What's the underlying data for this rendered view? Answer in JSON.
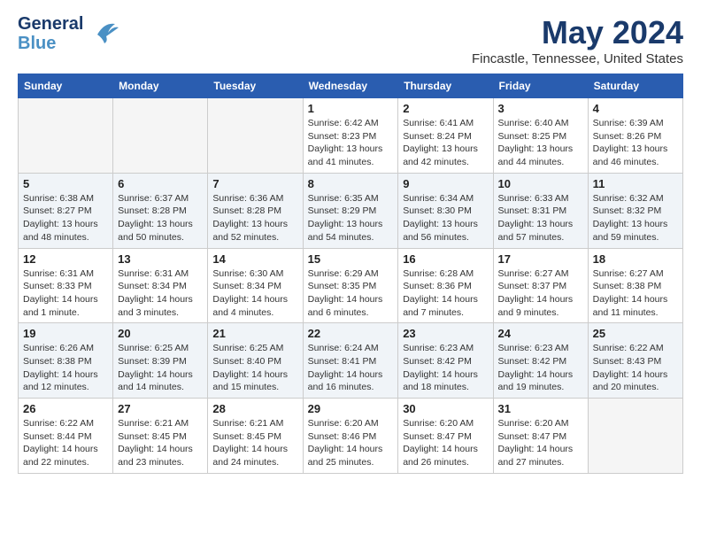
{
  "logo": {
    "general": "General",
    "blue": "Blue"
  },
  "title": "May 2024",
  "location": "Fincastle, Tennessee, United States",
  "days_of_week": [
    "Sunday",
    "Monday",
    "Tuesday",
    "Wednesday",
    "Thursday",
    "Friday",
    "Saturday"
  ],
  "weeks": [
    [
      {
        "day": "",
        "sunrise": "",
        "sunset": "",
        "daylight": "",
        "empty": true
      },
      {
        "day": "",
        "sunrise": "",
        "sunset": "",
        "daylight": "",
        "empty": true
      },
      {
        "day": "",
        "sunrise": "",
        "sunset": "",
        "daylight": "",
        "empty": true
      },
      {
        "day": "1",
        "sunrise": "Sunrise: 6:42 AM",
        "sunset": "Sunset: 8:23 PM",
        "daylight": "Daylight: 13 hours and 41 minutes."
      },
      {
        "day": "2",
        "sunrise": "Sunrise: 6:41 AM",
        "sunset": "Sunset: 8:24 PM",
        "daylight": "Daylight: 13 hours and 42 minutes."
      },
      {
        "day": "3",
        "sunrise": "Sunrise: 6:40 AM",
        "sunset": "Sunset: 8:25 PM",
        "daylight": "Daylight: 13 hours and 44 minutes."
      },
      {
        "day": "4",
        "sunrise": "Sunrise: 6:39 AM",
        "sunset": "Sunset: 8:26 PM",
        "daylight": "Daylight: 13 hours and 46 minutes."
      }
    ],
    [
      {
        "day": "5",
        "sunrise": "Sunrise: 6:38 AM",
        "sunset": "Sunset: 8:27 PM",
        "daylight": "Daylight: 13 hours and 48 minutes."
      },
      {
        "day": "6",
        "sunrise": "Sunrise: 6:37 AM",
        "sunset": "Sunset: 8:28 PM",
        "daylight": "Daylight: 13 hours and 50 minutes."
      },
      {
        "day": "7",
        "sunrise": "Sunrise: 6:36 AM",
        "sunset": "Sunset: 8:28 PM",
        "daylight": "Daylight: 13 hours and 52 minutes."
      },
      {
        "day": "8",
        "sunrise": "Sunrise: 6:35 AM",
        "sunset": "Sunset: 8:29 PM",
        "daylight": "Daylight: 13 hours and 54 minutes."
      },
      {
        "day": "9",
        "sunrise": "Sunrise: 6:34 AM",
        "sunset": "Sunset: 8:30 PM",
        "daylight": "Daylight: 13 hours and 56 minutes."
      },
      {
        "day": "10",
        "sunrise": "Sunrise: 6:33 AM",
        "sunset": "Sunset: 8:31 PM",
        "daylight": "Daylight: 13 hours and 57 minutes."
      },
      {
        "day": "11",
        "sunrise": "Sunrise: 6:32 AM",
        "sunset": "Sunset: 8:32 PM",
        "daylight": "Daylight: 13 hours and 59 minutes."
      }
    ],
    [
      {
        "day": "12",
        "sunrise": "Sunrise: 6:31 AM",
        "sunset": "Sunset: 8:33 PM",
        "daylight": "Daylight: 14 hours and 1 minute."
      },
      {
        "day": "13",
        "sunrise": "Sunrise: 6:31 AM",
        "sunset": "Sunset: 8:34 PM",
        "daylight": "Daylight: 14 hours and 3 minutes."
      },
      {
        "day": "14",
        "sunrise": "Sunrise: 6:30 AM",
        "sunset": "Sunset: 8:34 PM",
        "daylight": "Daylight: 14 hours and 4 minutes."
      },
      {
        "day": "15",
        "sunrise": "Sunrise: 6:29 AM",
        "sunset": "Sunset: 8:35 PM",
        "daylight": "Daylight: 14 hours and 6 minutes."
      },
      {
        "day": "16",
        "sunrise": "Sunrise: 6:28 AM",
        "sunset": "Sunset: 8:36 PM",
        "daylight": "Daylight: 14 hours and 7 minutes."
      },
      {
        "day": "17",
        "sunrise": "Sunrise: 6:27 AM",
        "sunset": "Sunset: 8:37 PM",
        "daylight": "Daylight: 14 hours and 9 minutes."
      },
      {
        "day": "18",
        "sunrise": "Sunrise: 6:27 AM",
        "sunset": "Sunset: 8:38 PM",
        "daylight": "Daylight: 14 hours and 11 minutes."
      }
    ],
    [
      {
        "day": "19",
        "sunrise": "Sunrise: 6:26 AM",
        "sunset": "Sunset: 8:38 PM",
        "daylight": "Daylight: 14 hours and 12 minutes."
      },
      {
        "day": "20",
        "sunrise": "Sunrise: 6:25 AM",
        "sunset": "Sunset: 8:39 PM",
        "daylight": "Daylight: 14 hours and 14 minutes."
      },
      {
        "day": "21",
        "sunrise": "Sunrise: 6:25 AM",
        "sunset": "Sunset: 8:40 PM",
        "daylight": "Daylight: 14 hours and 15 minutes."
      },
      {
        "day": "22",
        "sunrise": "Sunrise: 6:24 AM",
        "sunset": "Sunset: 8:41 PM",
        "daylight": "Daylight: 14 hours and 16 minutes."
      },
      {
        "day": "23",
        "sunrise": "Sunrise: 6:23 AM",
        "sunset": "Sunset: 8:42 PM",
        "daylight": "Daylight: 14 hours and 18 minutes."
      },
      {
        "day": "24",
        "sunrise": "Sunrise: 6:23 AM",
        "sunset": "Sunset: 8:42 PM",
        "daylight": "Daylight: 14 hours and 19 minutes."
      },
      {
        "day": "25",
        "sunrise": "Sunrise: 6:22 AM",
        "sunset": "Sunset: 8:43 PM",
        "daylight": "Daylight: 14 hours and 20 minutes."
      }
    ],
    [
      {
        "day": "26",
        "sunrise": "Sunrise: 6:22 AM",
        "sunset": "Sunset: 8:44 PM",
        "daylight": "Daylight: 14 hours and 22 minutes."
      },
      {
        "day": "27",
        "sunrise": "Sunrise: 6:21 AM",
        "sunset": "Sunset: 8:45 PM",
        "daylight": "Daylight: 14 hours and 23 minutes."
      },
      {
        "day": "28",
        "sunrise": "Sunrise: 6:21 AM",
        "sunset": "Sunset: 8:45 PM",
        "daylight": "Daylight: 14 hours and 24 minutes."
      },
      {
        "day": "29",
        "sunrise": "Sunrise: 6:20 AM",
        "sunset": "Sunset: 8:46 PM",
        "daylight": "Daylight: 14 hours and 25 minutes."
      },
      {
        "day": "30",
        "sunrise": "Sunrise: 6:20 AM",
        "sunset": "Sunset: 8:47 PM",
        "daylight": "Daylight: 14 hours and 26 minutes."
      },
      {
        "day": "31",
        "sunrise": "Sunrise: 6:20 AM",
        "sunset": "Sunset: 8:47 PM",
        "daylight": "Daylight: 14 hours and 27 minutes."
      },
      {
        "day": "",
        "sunrise": "",
        "sunset": "",
        "daylight": "",
        "empty": true
      }
    ]
  ]
}
